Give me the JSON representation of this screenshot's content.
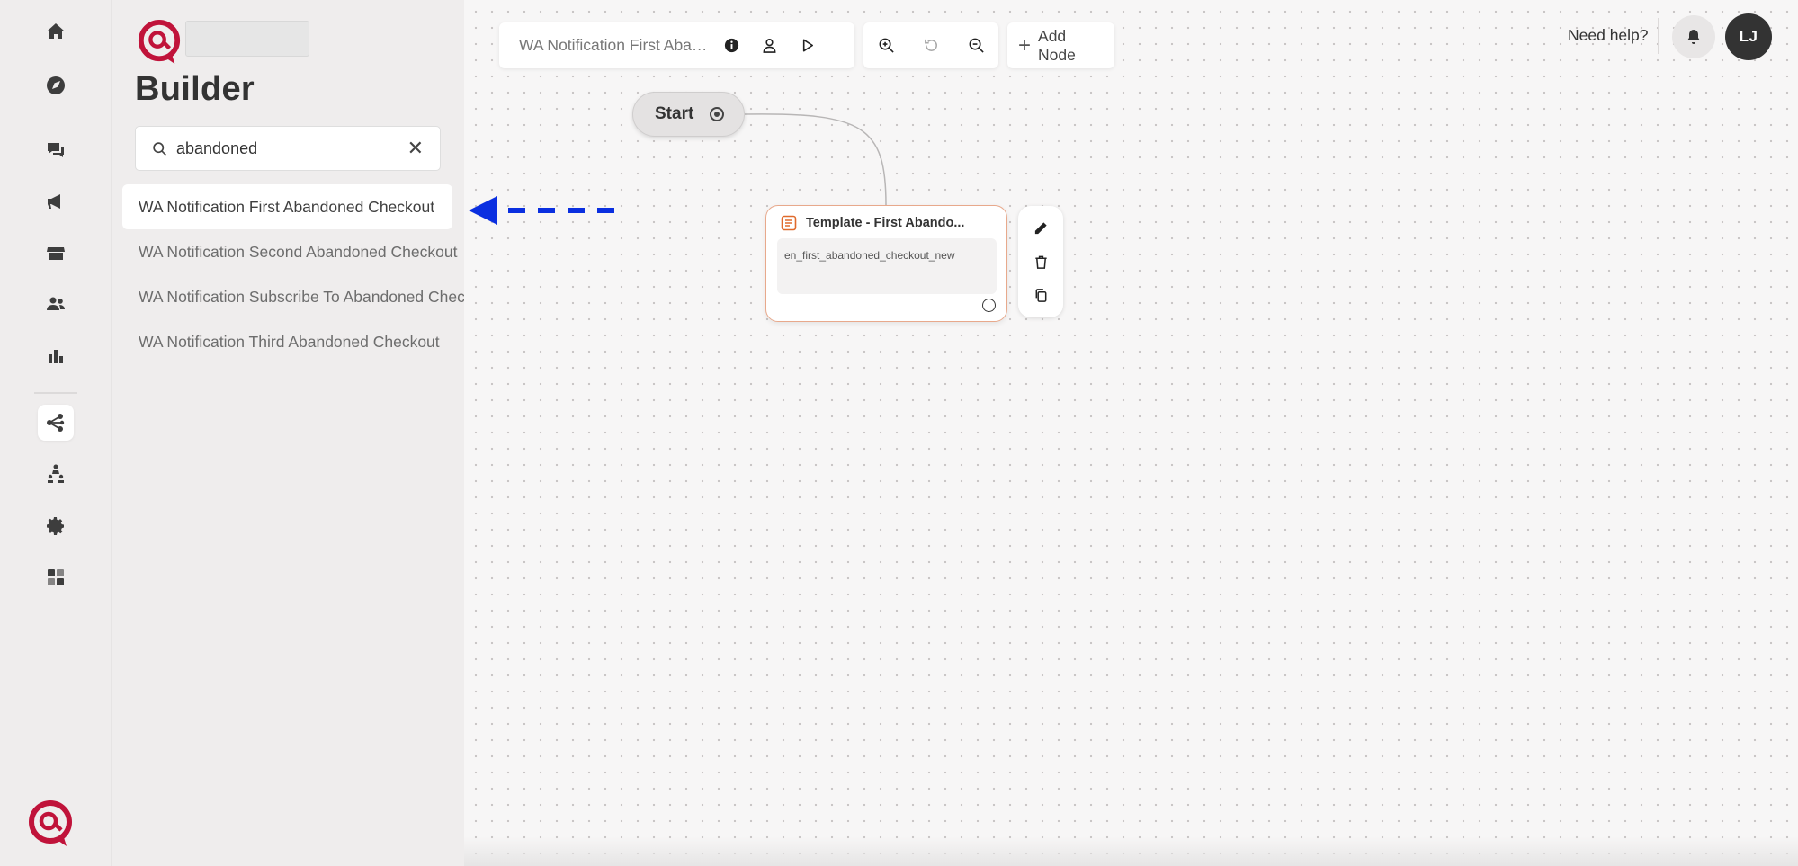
{
  "panel": {
    "title": "Builder",
    "search": {
      "value": "abandoned",
      "placeholder": "Search"
    },
    "flows": [
      {
        "label": "WA Notification First Abandoned Checkout",
        "selected": true
      },
      {
        "label": "WA Notification Second Abandoned Checkout",
        "selected": false
      },
      {
        "label": "WA Notification Subscribe To Abandoned Checkout",
        "selected": false
      },
      {
        "label": "WA Notification Third Abandoned Checkout",
        "selected": false
      }
    ]
  },
  "toolbar": {
    "flow_name": "WA Notification First Abandoned Checkout",
    "add_node_label": "Add Node"
  },
  "header": {
    "help_label": "Need help?",
    "avatar_initials": "LJ"
  },
  "canvas": {
    "start_label": "Start",
    "template_node": {
      "title": "Template - First Abando...",
      "body": "en_first_abandoned_checkout_new"
    }
  },
  "rail": {
    "icons": [
      "home-icon",
      "rocket-icon",
      "chat-icon",
      "megaphone-icon",
      "store-icon",
      "users-icon",
      "bar-chart-icon",
      "flow-builder-icon",
      "hierarchy-icon",
      "gear-icon",
      "integrations-icon"
    ]
  },
  "colors": {
    "brand": "#c0133a",
    "annotation_arrow": "#0a2fe0",
    "node_border": "#e8a98c",
    "template_icon": "#e06a2c"
  }
}
